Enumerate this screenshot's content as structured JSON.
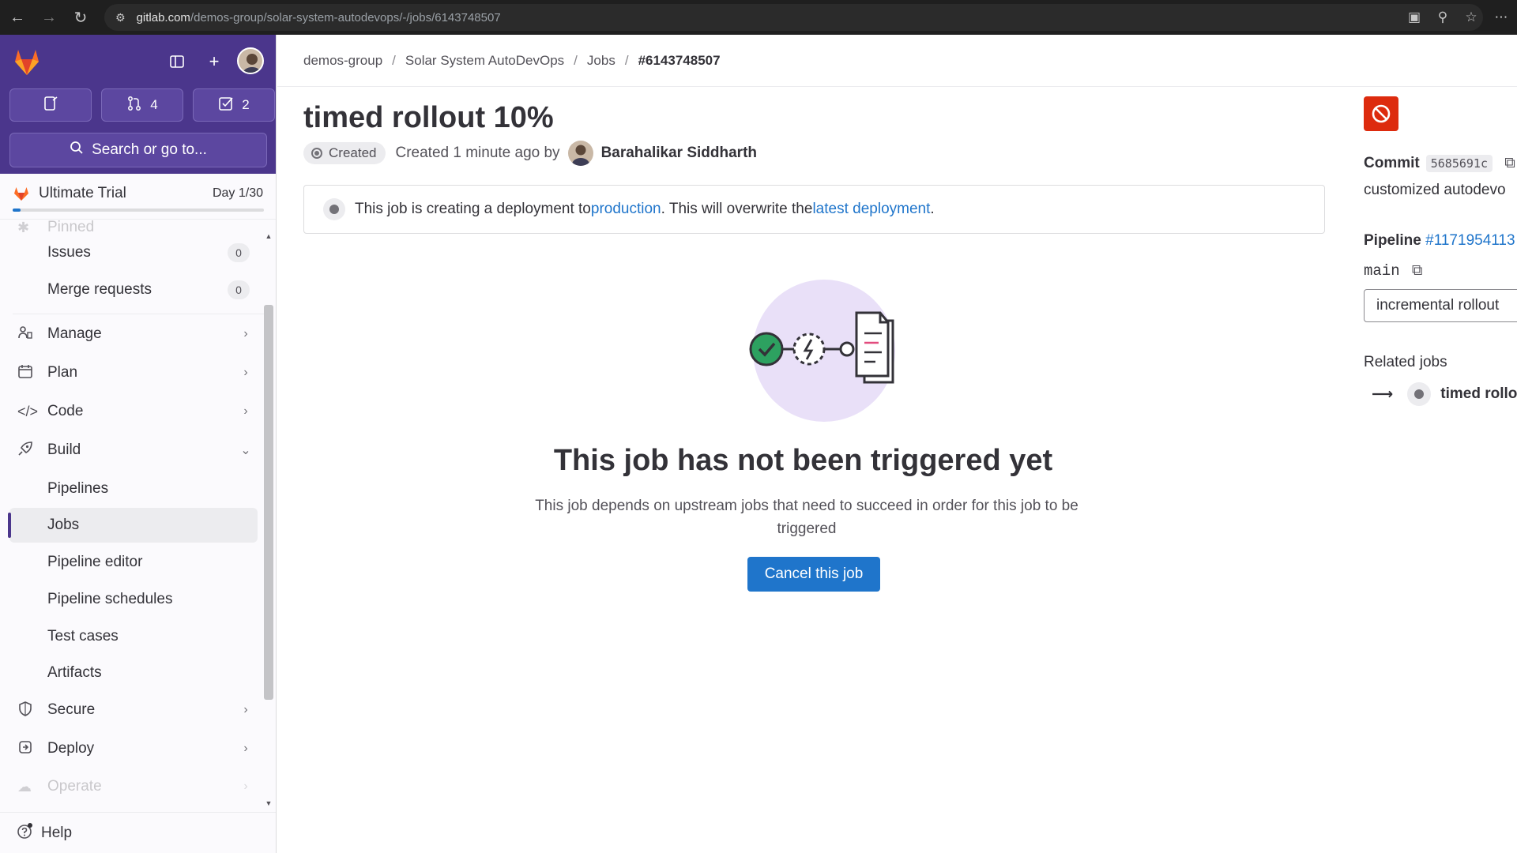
{
  "browser": {
    "url_domain": "gitlab.com",
    "url_path": "/demos-group/solar-system-autodevops/-/jobs/6143748507"
  },
  "sidebar": {
    "merge_requests_count": "4",
    "todos_count": "2",
    "search_label": "Search or go to...",
    "trial": {
      "label": "Ultimate Trial",
      "day": "Day 1/30",
      "progress": 0.033
    },
    "faded_top_label": "Pinned",
    "items": [
      {
        "label": "Issues",
        "count": "0"
      },
      {
        "label": "Merge requests",
        "count": "0"
      },
      {
        "label": "Manage"
      },
      {
        "label": "Plan"
      },
      {
        "label": "Code"
      },
      {
        "label": "Build"
      },
      {
        "label": "Pipelines"
      },
      {
        "label": "Jobs"
      },
      {
        "label": "Pipeline editor"
      },
      {
        "label": "Pipeline schedules"
      },
      {
        "label": "Test cases"
      },
      {
        "label": "Artifacts"
      },
      {
        "label": "Secure"
      },
      {
        "label": "Deploy"
      },
      {
        "label": "Operate"
      }
    ],
    "help_label": "Help"
  },
  "breadcrumb": [
    "demos-group",
    "Solar System AutoDevOps",
    "Jobs",
    "#6143748507"
  ],
  "job": {
    "title": "timed rollout 10%",
    "status": "Created",
    "created_text": "Created 1 minute ago by",
    "author": "Barahalikar Siddharth"
  },
  "alert": {
    "text_before": "This job is creating a deployment to ",
    "link1": "production",
    "text_middle": ". This will overwrite the ",
    "link2": "latest deployment",
    "text_after": "."
  },
  "empty_state": {
    "title": "This job has not been triggered yet",
    "description": "This job depends on upstream jobs that need to succeed in order for this job to be triggered",
    "button": "Cancel this job"
  },
  "right_panel": {
    "commit_label": "Commit",
    "commit_sha": "5685691c",
    "commit_message": "customized autodevo",
    "pipeline_label": "Pipeline",
    "pipeline_id": "#1171954113",
    "branch": "main",
    "stage_value": "incremental rollout",
    "related_jobs_label": "Related jobs",
    "related_job": "timed rollou"
  },
  "colors": {
    "brand_purple": "#4b368c",
    "link_blue": "#1f75cb",
    "danger_red": "#dd2b0e"
  }
}
